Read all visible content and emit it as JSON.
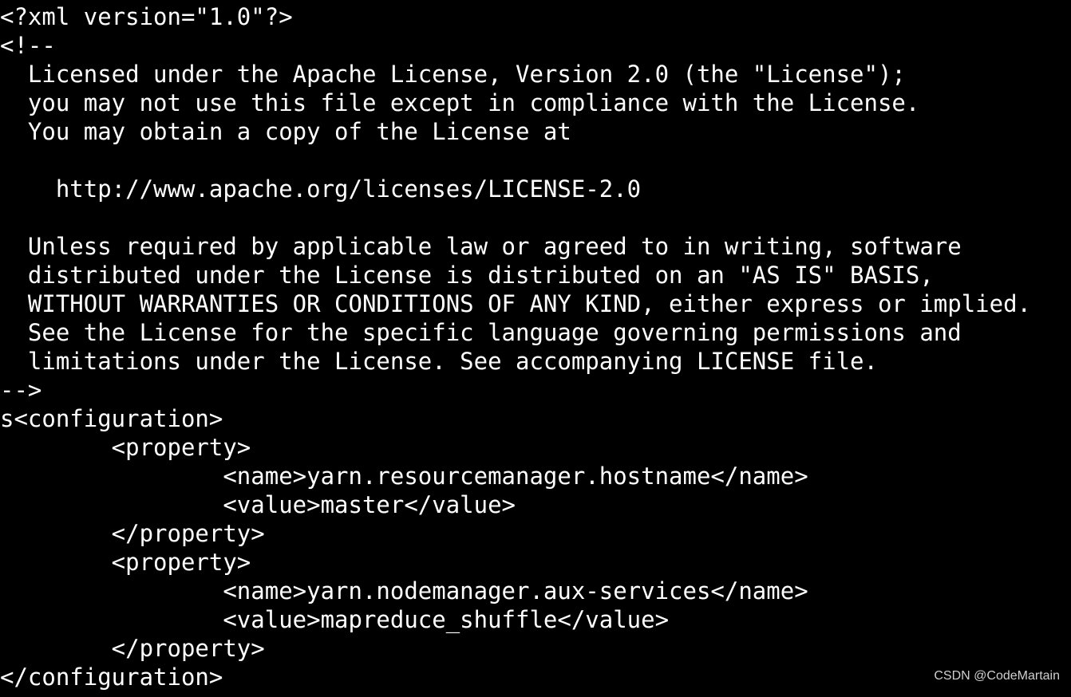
{
  "terminal": {
    "lines": [
      "<?xml version=\"1.0\"?>",
      "<!--",
      "  Licensed under the Apache License, Version 2.0 (the \"License\");",
      "  you may not use this file except in compliance with the License.",
      "  You may obtain a copy of the License at",
      "",
      "    http://www.apache.org/licenses/LICENSE-2.0",
      "",
      "  Unless required by applicable law or agreed to in writing, software",
      "  distributed under the License is distributed on an \"AS IS\" BASIS,",
      "  WITHOUT WARRANTIES OR CONDITIONS OF ANY KIND, either express or implied.",
      "  See the License for the specific language governing permissions and",
      "  limitations under the License. See accompanying LICENSE file.",
      "-->",
      "s<configuration>",
      "        <property>",
      "                <name>yarn.resourcemanager.hostname</name>",
      "                <value>master</value>",
      "        </property>",
      "        <property>",
      "                <name>yarn.nodemanager.aux-services</name>",
      "                <value>mapreduce_shuffle</value>",
      "        </property>",
      "</configuration>"
    ]
  },
  "watermark": {
    "text": "CSDN @CodeMartain"
  },
  "colors": {
    "background": "#000000",
    "text": "#ffffff"
  }
}
